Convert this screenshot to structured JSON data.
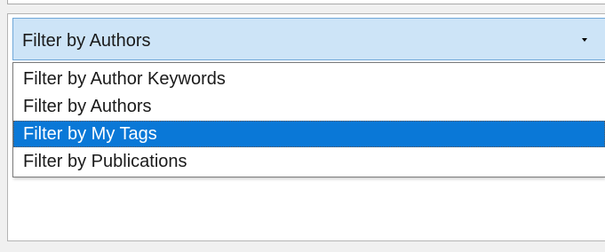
{
  "combo": {
    "selected": "Filter by Authors",
    "arrow_icon": "dropdown-arrow-icon"
  },
  "dropdown": {
    "options": [
      "Filter by Author Keywords",
      "Filter by Authors",
      "Filter by My Tags",
      "Filter by Publications"
    ],
    "highlighted": "Filter by My Tags"
  },
  "colors": {
    "combo_background": "#cde4f7",
    "combo_border": "#6fa7d8",
    "highlight": "#0a78d7"
  }
}
